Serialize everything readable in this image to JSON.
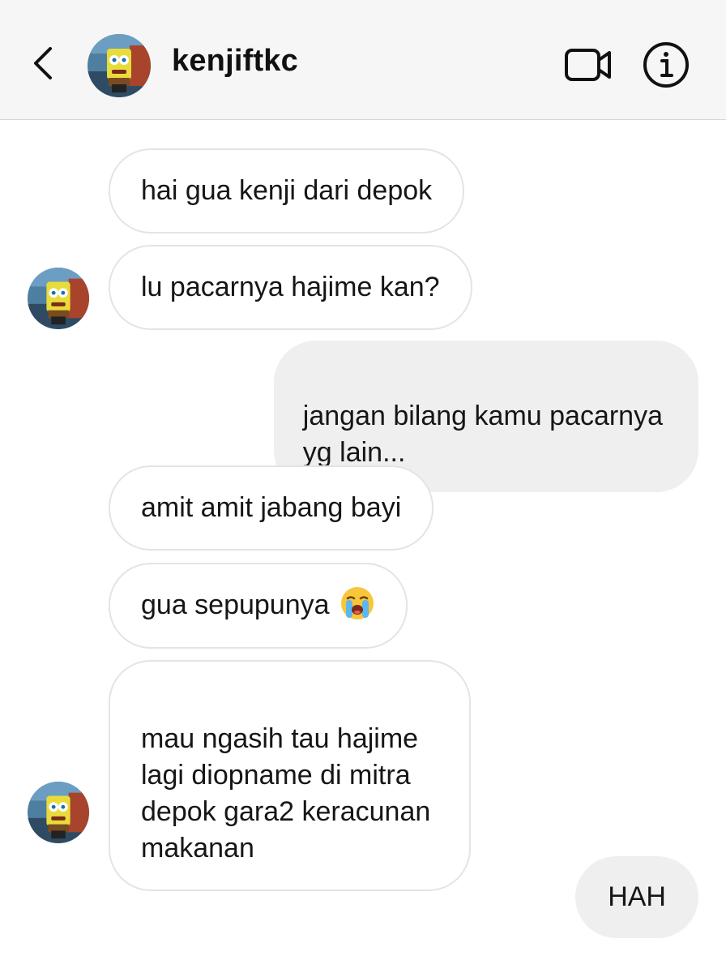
{
  "header": {
    "username": "kenjiftkc",
    "back_icon": "chevron-left-icon",
    "video_icon": "video-camera-icon",
    "info_icon": "info-icon"
  },
  "messages": [
    {
      "direction": "incoming",
      "text": "hai gua kenji dari depok"
    },
    {
      "direction": "incoming",
      "text": "lu pacarnya hajime kan?"
    },
    {
      "direction": "outgoing",
      "text": "jangan bilang kamu pacarnya\nyg lain..."
    },
    {
      "direction": "incoming",
      "text": "amit amit jabang bayi"
    },
    {
      "direction": "incoming",
      "text": "gua sepupunya",
      "emoji": "loudly-crying-face-emoji"
    },
    {
      "direction": "incoming",
      "text": "mau ngasih tau hajime\nlagi diopname di mitra\ndepok gara2 keracunan\nmakanan"
    },
    {
      "direction": "outgoing",
      "text": "HAH"
    }
  ],
  "colors": {
    "header_bg": "#f6f6f6",
    "incoming_border": "#e4e4e4",
    "outgoing_bg": "#efefef",
    "text": "#161616"
  }
}
